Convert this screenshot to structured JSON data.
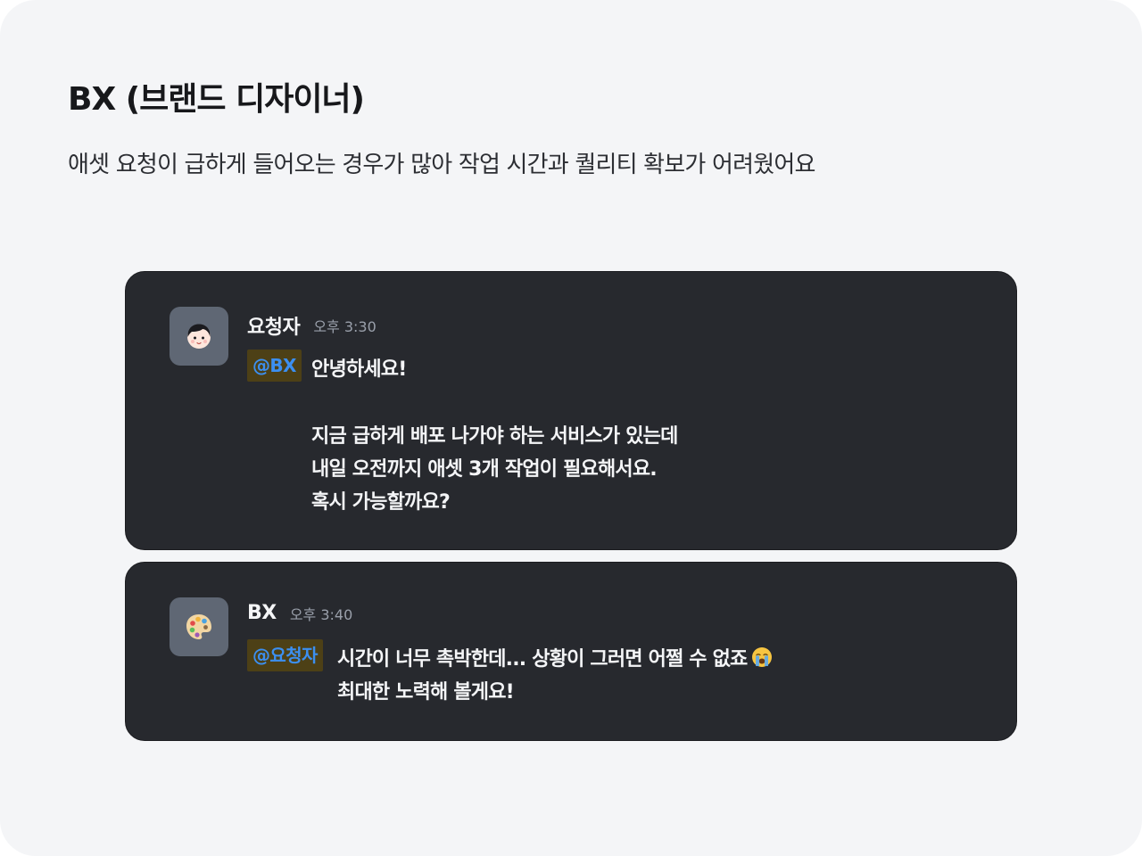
{
  "page": {
    "title": "BX (브랜드 디자이너)",
    "subtitle": "애셋 요청이 급하게 들어오는 경우가 많아 작업 시간과 퀄리티 확보가 어려웠어요"
  },
  "messages": [
    {
      "author": "요청자",
      "time": "오후 3:30",
      "avatar_icon": "person-face-icon",
      "mention": "@BX",
      "lines": [
        "안녕하세요!",
        "지금 급하게 배포 나가야 하는 서비스가 있는데",
        "내일 오전까지 애셋 3개 작업이 필요해서요.",
        "혹시 가능할까요?"
      ]
    },
    {
      "author": "BX",
      "time": "오후 3:40",
      "avatar_icon": "palette-icon",
      "mention": "@요청자",
      "lines": [
        "시간이 너무 촉박한데... 상황이 그러면 어쩔 수 없죠",
        "최대한 노력해 볼게요!"
      ],
      "emoji_icon": "crying-face-icon"
    }
  ],
  "colors": {
    "page_bg": "#f4f5f7",
    "card_bg": "#27292e",
    "mention_text": "#3c8ff0",
    "mention_bg": "#4d4016"
  }
}
